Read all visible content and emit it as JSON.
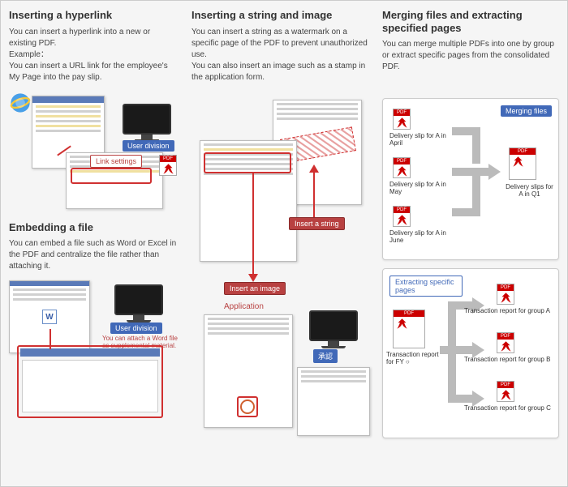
{
  "col1": {
    "h1": "Inserting a hyperlink",
    "p1": "You can insert a hyperlink into a new or existing PDF.\nExample：\nYou can insert a URL link for the employee's My Page into the pay slip.",
    "link_settings": "Link settings",
    "user_division": "User division",
    "h2": "Embedding a file",
    "p2": "You can embed a file such as Word or Excel in the PDF and centralize the file rather than attaching it.",
    "attach_note": "You can attach a Word file as supplemental material."
  },
  "col2": {
    "h1": "Inserting a string and image",
    "p1": "You can insert a string as a watermark on a specific page of the PDF to prevent unauthorized use.\nYou can also insert an image such as a stamp in the application form.",
    "insert_string": "Insert a string",
    "insert_image": "Insert an image",
    "application": "Application",
    "approval": "承認"
  },
  "col3": {
    "h1": "Merging files and extracting specified pages",
    "p1": "You can merge multiple PDFs into one by group or extract specific pages from the consolidated PDF.",
    "merging": "Merging files",
    "slip_apr": "Delivery slip for A in April",
    "slip_may": "Delivery slip for A in May",
    "slip_jun": "Delivery slip for A in June",
    "slip_q1": "Delivery slips for A in Q1",
    "extracting": "Extracting specific pages",
    "txn_fy": "Transaction report for FY ○",
    "txn_a": "Transaction report for group A",
    "txn_b": "Transaction report for group B",
    "txn_c": "Transaction report for group C"
  }
}
